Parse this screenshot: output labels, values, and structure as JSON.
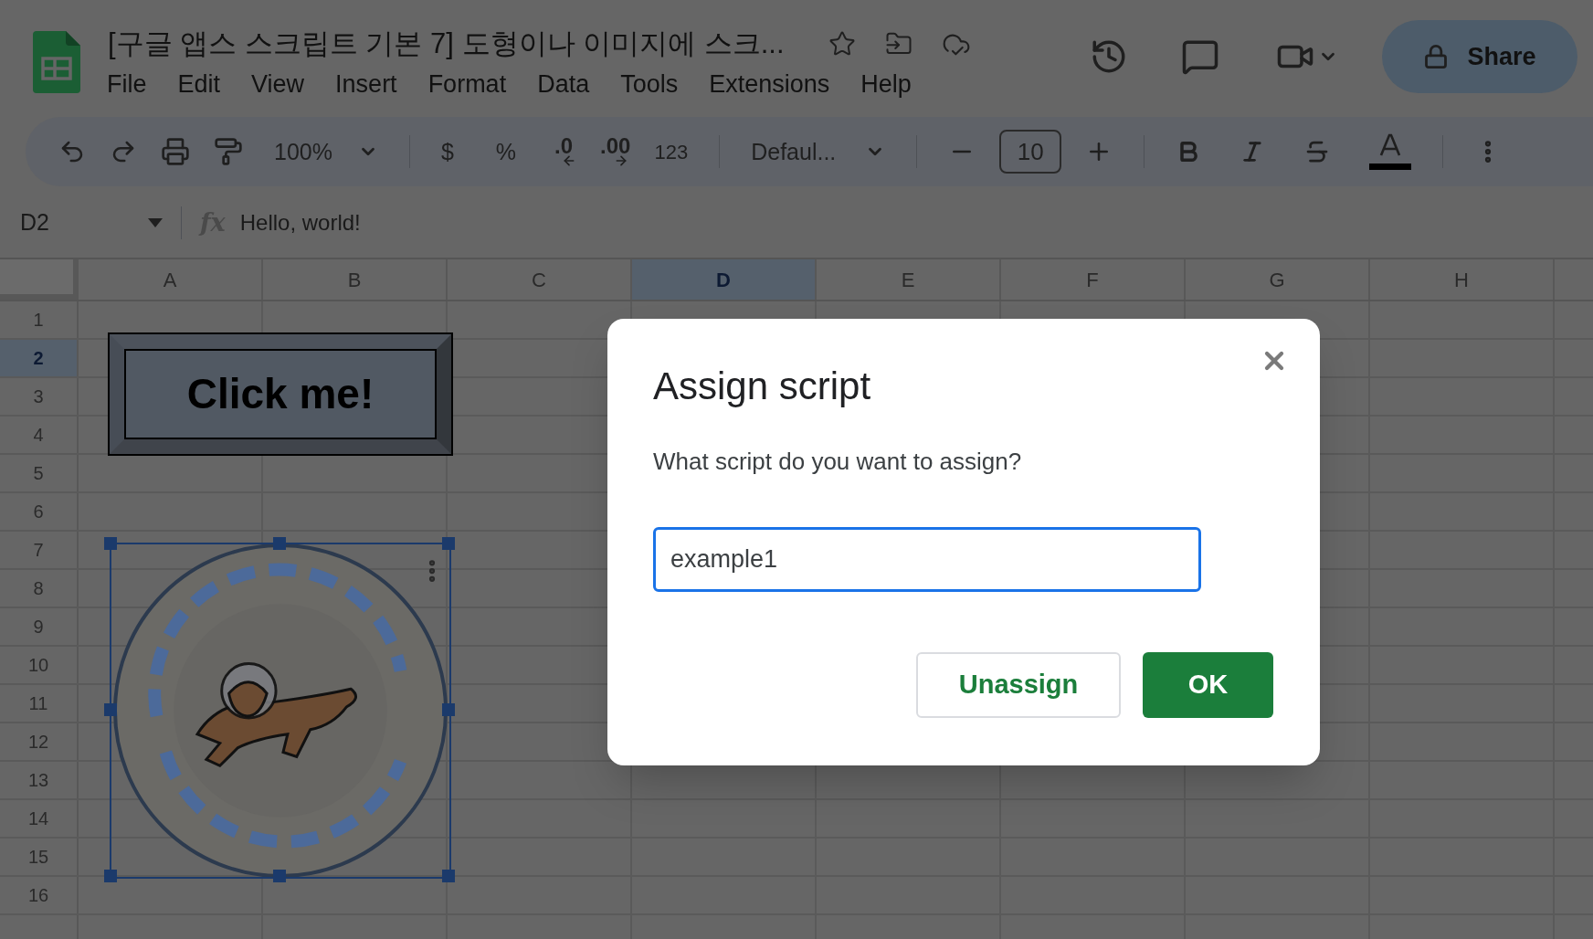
{
  "document": {
    "title": "[구글 앱스 스크립트 기본 7] 도형이나 이미지에 스크..."
  },
  "menu": [
    "File",
    "Edit",
    "View",
    "Insert",
    "Format",
    "Data",
    "Tools",
    "Extensions",
    "Help"
  ],
  "share_button": {
    "label": "Share"
  },
  "toolbar": {
    "zoom": "100%",
    "currency": "$",
    "percent": "%",
    "decrease_decimals": ".0",
    "increase_decimals": ".00",
    "number_format": "123",
    "font": "Defaul...",
    "font_size": "10"
  },
  "formula_bar": {
    "cell_ref": "D2",
    "fx": "fx",
    "content": "Hello, world!"
  },
  "sheet": {
    "columns": [
      {
        "label": "A",
        "selected": false
      },
      {
        "label": "B",
        "selected": false
      },
      {
        "label": "C",
        "selected": false
      },
      {
        "label": "D",
        "selected": true
      },
      {
        "label": "E",
        "selected": false
      },
      {
        "label": "F",
        "selected": false
      },
      {
        "label": "G",
        "selected": false
      },
      {
        "label": "H",
        "selected": false
      }
    ],
    "rows": [
      {
        "label": "1",
        "selected": false
      },
      {
        "label": "2",
        "selected": true
      },
      {
        "label": "3",
        "selected": false
      },
      {
        "label": "4",
        "selected": false
      },
      {
        "label": "5",
        "selected": false
      },
      {
        "label": "6",
        "selected": false
      },
      {
        "label": "7",
        "selected": false
      },
      {
        "label": "8",
        "selected": false
      },
      {
        "label": "9",
        "selected": false
      },
      {
        "label": "10",
        "selected": false
      },
      {
        "label": "11",
        "selected": false
      },
      {
        "label": "12",
        "selected": false
      },
      {
        "label": "13",
        "selected": false
      },
      {
        "label": "14",
        "selected": false
      },
      {
        "label": "15",
        "selected": false
      },
      {
        "label": "16",
        "selected": false
      }
    ]
  },
  "drawing_button": {
    "label": "Click me!"
  },
  "image": {
    "kind": "picture",
    "selected": true
  },
  "dialog": {
    "title": "Assign script",
    "prompt": "What script do you want to assign?",
    "field": {
      "value": "example1"
    },
    "buttons": [
      {
        "label": "Unassign",
        "kind": "secondary"
      },
      {
        "label": "OK",
        "kind": "primary"
      }
    ]
  }
}
